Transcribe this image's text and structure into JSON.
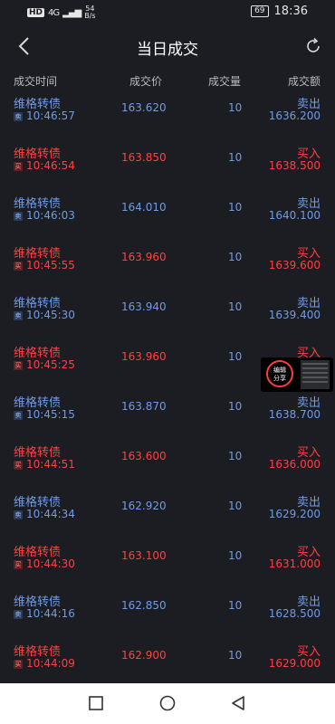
{
  "status": {
    "network_badge": "HD",
    "signal": "4G",
    "speed_value": "54",
    "speed_unit": "B/s",
    "battery": "69",
    "time": "18:36"
  },
  "header": {
    "title": "当日成交"
  },
  "columns": {
    "time": "成交时间",
    "price": "成交价",
    "volume": "成交量",
    "amount": "成交额"
  },
  "rows": [
    {
      "name": "维格转债",
      "tag": "卖",
      "time": "10:46:57",
      "price": "163.620",
      "volume": "10",
      "side": "卖出",
      "amount": "1636.200",
      "type": "sell"
    },
    {
      "name": "维格转债",
      "tag": "买",
      "time": "10:46:54",
      "price": "163.850",
      "volume": "10",
      "side": "买入",
      "amount": "1638.500",
      "type": "buy"
    },
    {
      "name": "维格转债",
      "tag": "卖",
      "time": "10:46:03",
      "price": "164.010",
      "volume": "10",
      "side": "卖出",
      "amount": "1640.100",
      "type": "sell"
    },
    {
      "name": "维格转债",
      "tag": "买",
      "time": "10:45:55",
      "price": "163.960",
      "volume": "10",
      "side": "买入",
      "amount": "1639.600",
      "type": "buy"
    },
    {
      "name": "维格转债",
      "tag": "卖",
      "time": "10:45:30",
      "price": "163.940",
      "volume": "10",
      "side": "卖出",
      "amount": "1639.400",
      "type": "sell"
    },
    {
      "name": "维格转债",
      "tag": "买",
      "time": "10:45:25",
      "price": "163.960",
      "volume": "10",
      "side": "买入",
      "amount": "",
      "type": "buy"
    },
    {
      "name": "维格转债",
      "tag": "卖",
      "time": "10:45:15",
      "price": "163.870",
      "volume": "10",
      "side": "卖出",
      "amount": "1638.700",
      "type": "sell"
    },
    {
      "name": "维格转债",
      "tag": "买",
      "time": "10:44:51",
      "price": "163.600",
      "volume": "10",
      "side": "买入",
      "amount": "1636.000",
      "type": "buy"
    },
    {
      "name": "维格转债",
      "tag": "卖",
      "time": "10:44:34",
      "price": "162.920",
      "volume": "10",
      "side": "卖出",
      "amount": "1629.200",
      "type": "sell"
    },
    {
      "name": "维格转债",
      "tag": "买",
      "time": "10:44:30",
      "price": "163.100",
      "volume": "10",
      "side": "买入",
      "amount": "1631.000",
      "type": "buy"
    },
    {
      "name": "维格转债",
      "tag": "卖",
      "time": "10:44:16",
      "price": "162.850",
      "volume": "10",
      "side": "卖出",
      "amount": "1628.500",
      "type": "sell"
    },
    {
      "name": "维格转债",
      "tag": "买",
      "time": "10:44:09",
      "price": "162.900",
      "volume": "10",
      "side": "买入",
      "amount": "1629.000",
      "type": "buy"
    }
  ],
  "floating": {
    "label_line1": "编辑",
    "label_line2": "分享"
  },
  "colors": {
    "background": "#1c1d22",
    "sell": "#6f9be8",
    "buy": "#ff4040"
  },
  "icons": {
    "back": "back-arrow-icon",
    "refresh": "refresh-icon",
    "nav_back": "triangle-back-icon",
    "nav_home": "circle-home-icon",
    "nav_recents": "square-recents-icon"
  }
}
